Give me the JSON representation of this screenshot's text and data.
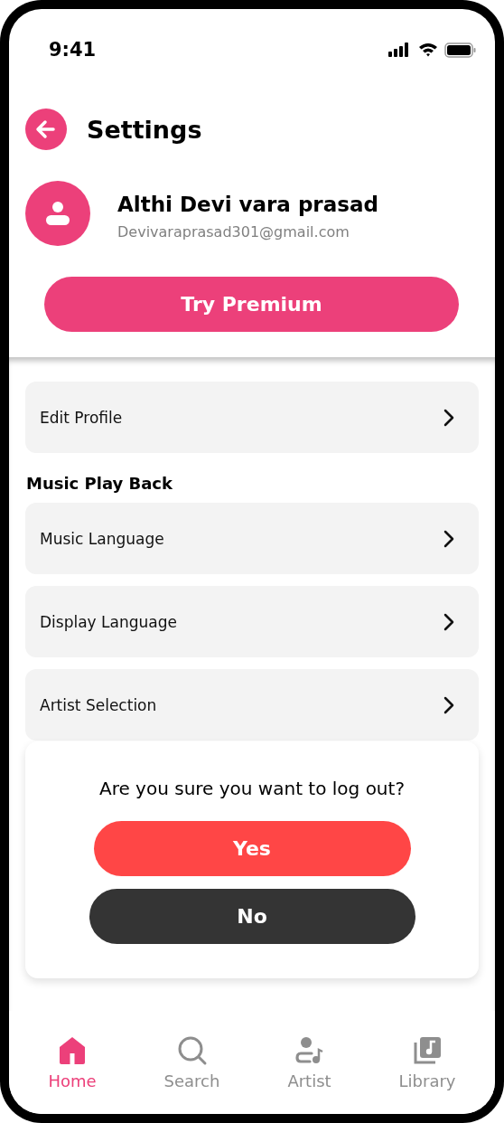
{
  "status_bar": {
    "time": "9:41"
  },
  "header": {
    "title": "Settings"
  },
  "profile": {
    "name": "Althi Devi vara prasad",
    "email": "Devivaraprasad301@gmail.com"
  },
  "premium_button": "Try Premium",
  "items": [
    {
      "label": "Edit Profile",
      "kind": "row"
    },
    {
      "label": "Music Play Back",
      "kind": "section"
    },
    {
      "label": "Music Language",
      "kind": "row"
    },
    {
      "label": "Display Language",
      "kind": "row"
    },
    {
      "label": "Artist Selection",
      "kind": "row"
    }
  ],
  "dialog": {
    "message": "Are you sure you want to log out?",
    "buttons": [
      {
        "label": "Yes",
        "kind": "confirm"
      },
      {
        "label": "No",
        "kind": "cancel"
      }
    ]
  },
  "nav": [
    {
      "label": "Home",
      "kind": "home",
      "selected": true
    },
    {
      "label": "Search",
      "kind": "search",
      "selected": false
    },
    {
      "label": "Artist",
      "kind": "artist",
      "selected": false
    },
    {
      "label": "Library",
      "kind": "library",
      "selected": false
    }
  ]
}
